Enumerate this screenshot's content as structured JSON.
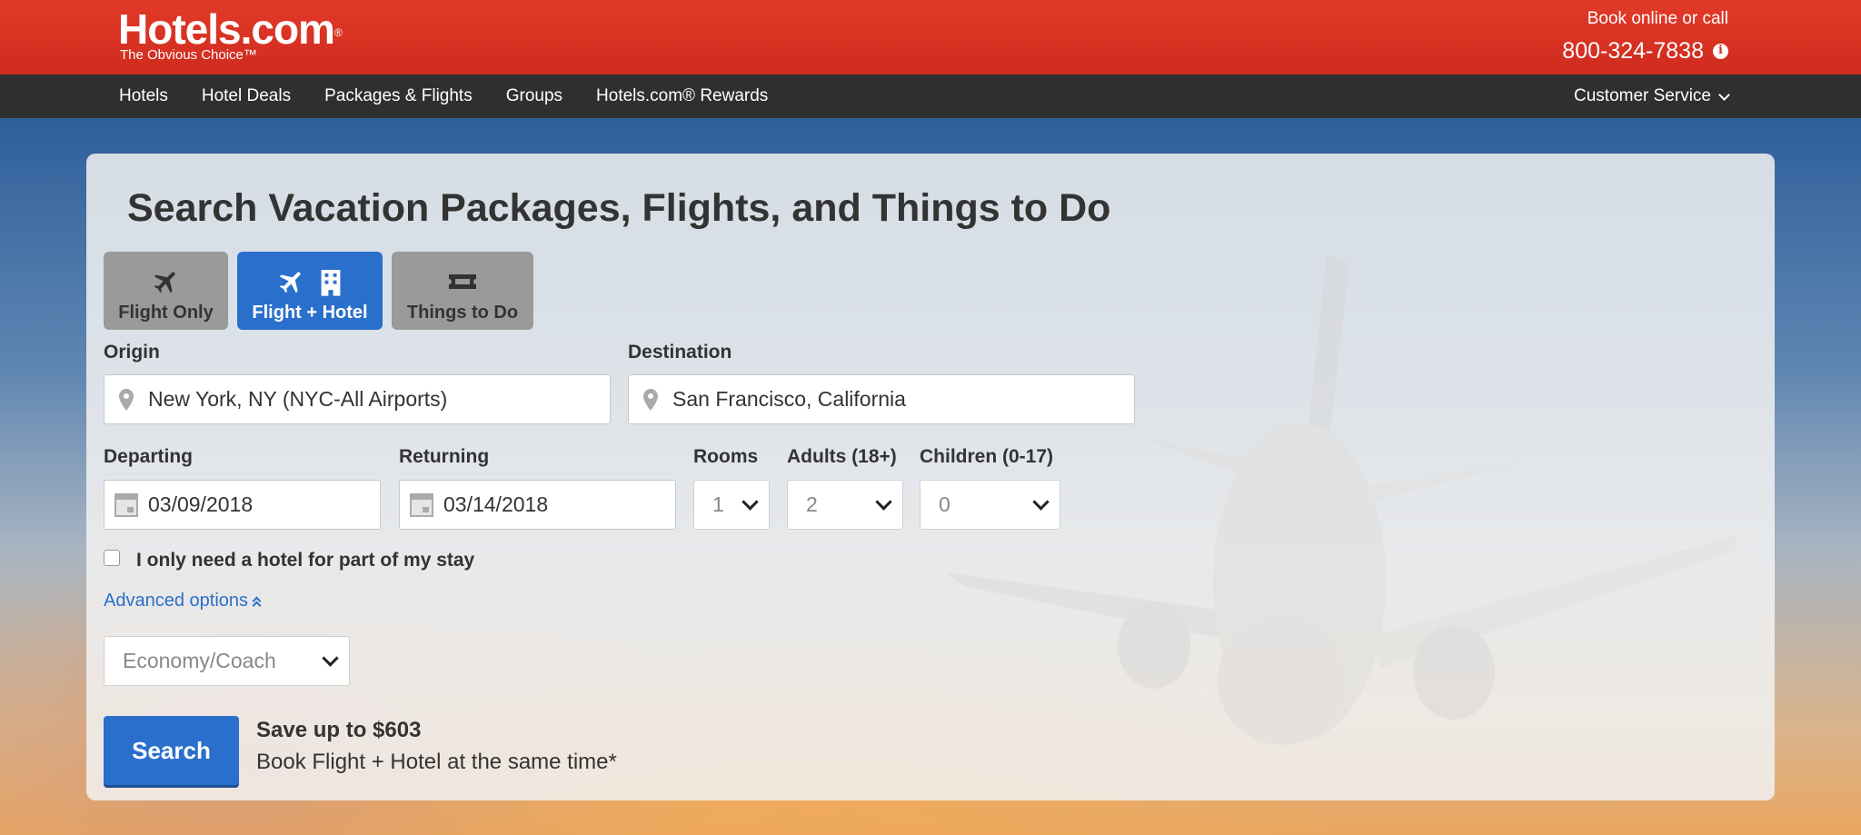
{
  "header": {
    "logo_name": "Hotels.com",
    "logo_reg": "®",
    "logo_tagline": "The Obvious Choice™",
    "book_label": "Book online or call",
    "phone": "800-324-7838",
    "info_icon": "i"
  },
  "nav": {
    "items": [
      {
        "label": "Hotels"
      },
      {
        "label": "Hotel Deals"
      },
      {
        "label": "Packages & Flights"
      },
      {
        "label": "Groups"
      },
      {
        "label": "Hotels.com® Rewards"
      }
    ],
    "customer_service": "Customer Service"
  },
  "search": {
    "title": "Search Vacation Packages, Flights, and Things to Do",
    "tabs": [
      {
        "label": "Flight Only",
        "icon": "airplane-icon"
      },
      {
        "label": "Flight + Hotel",
        "icon": "airplane-hotel-icon",
        "active": true
      },
      {
        "label": "Things to Do",
        "icon": "ticket-icon"
      }
    ],
    "origin_label": "Origin",
    "origin_value": "New York, NY (NYC-All Airports)",
    "destination_label": "Destination",
    "destination_value": "San Francisco, California",
    "departing_label": "Departing",
    "departing_value": "03/09/2018",
    "returning_label": "Returning",
    "returning_value": "03/14/2018",
    "rooms_label": "Rooms",
    "rooms_value": "1",
    "adults_label": "Adults (18+)",
    "adults_value": "2",
    "children_label": "Children (0-17)",
    "children_value": "0",
    "partial_stay_label": "I only need a hotel for part of my stay",
    "advanced_options": "Advanced options",
    "cabin_class": "Economy/Coach",
    "search_button": "Search",
    "save_headline": "Save up to $603",
    "save_sub": "Book Flight + Hotel at the same time*"
  },
  "colors": {
    "brand_red": "#d52f21",
    "accent_blue": "#2b6fcc",
    "nav_dark": "#2f2f2f"
  }
}
